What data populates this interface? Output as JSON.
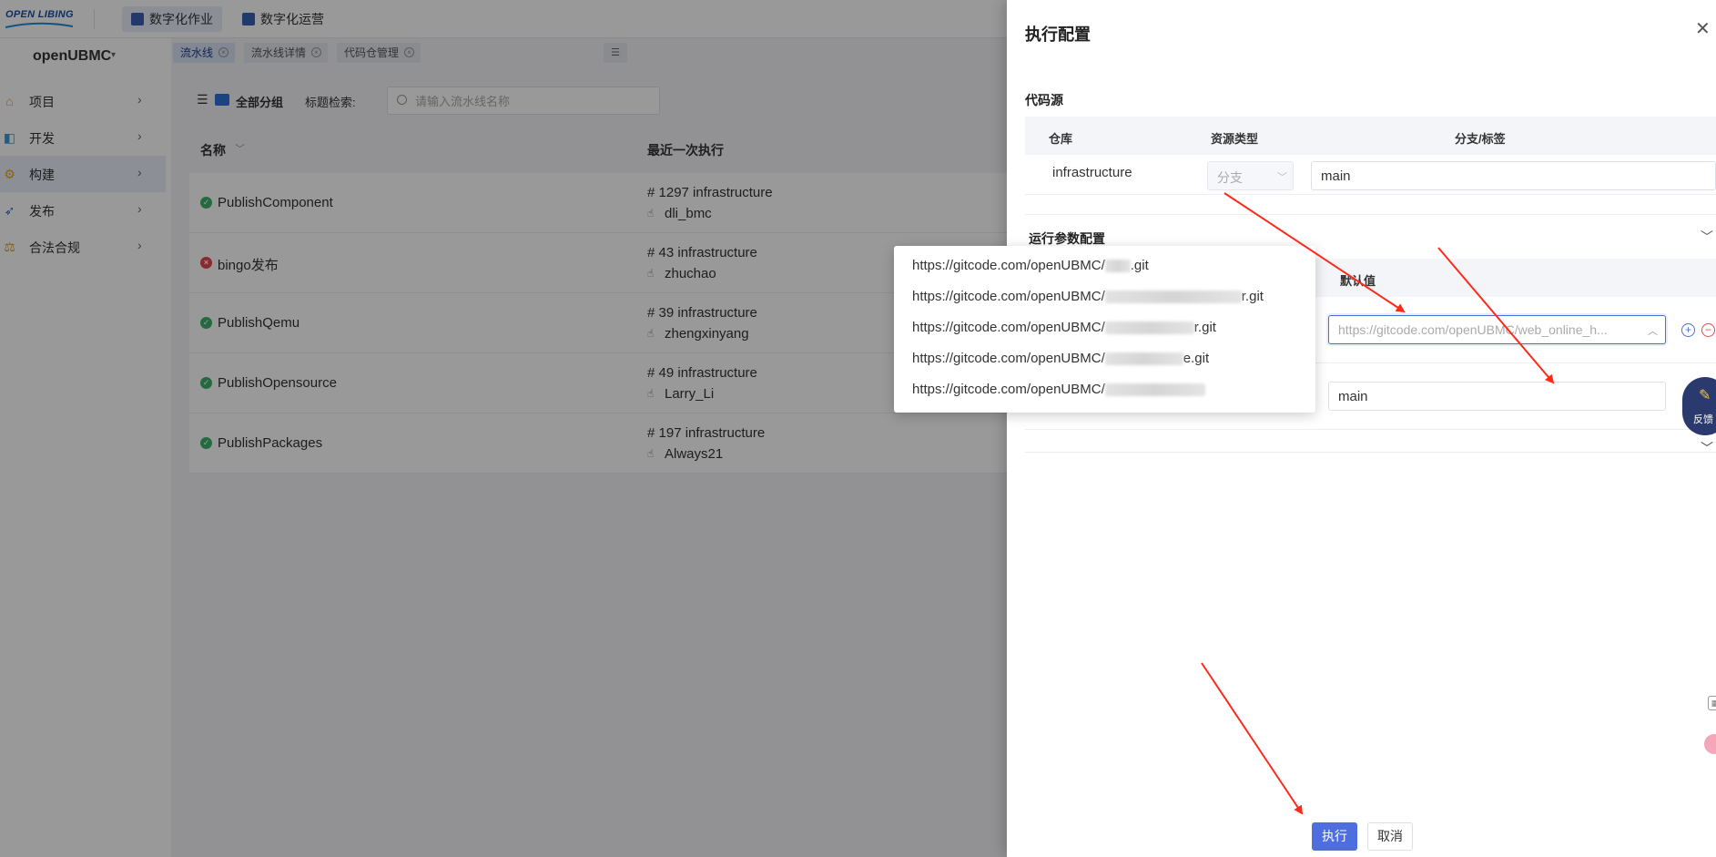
{
  "logo": {
    "text": "OPEN LIBING"
  },
  "top_tabs": [
    {
      "label": "数字化作业"
    },
    {
      "label": "数字化运营"
    }
  ],
  "org": {
    "name": "openUBMC",
    "caret": "▾"
  },
  "sidebar": {
    "items": [
      {
        "label": "项目",
        "icon": "home-icon"
      },
      {
        "label": "开发",
        "icon": "code-icon"
      },
      {
        "label": "构建",
        "icon": "gear-icon"
      },
      {
        "label": "发布",
        "icon": "rocket-icon"
      },
      {
        "label": "合法合规",
        "icon": "scale-icon"
      }
    ]
  },
  "sub_tabs": [
    {
      "label": "流水线"
    },
    {
      "label": "流水线详情"
    },
    {
      "label": "代码仓管理"
    }
  ],
  "filter": {
    "group_label": "全部分组",
    "search_label": "标题检索:",
    "search_placeholder": "请输入流水线名称"
  },
  "pipeline_table": {
    "headers": {
      "name": "名称",
      "last_run": "最近一次执行"
    },
    "rows": [
      {
        "status": "success",
        "name": "PublishComponent",
        "build": "# 1297 infrastructure",
        "user": "dli_bmc"
      },
      {
        "status": "failed",
        "name": "bingo发布",
        "build": "# 43 infrastructure",
        "user": "zhuchao"
      },
      {
        "status": "success",
        "name": "PublishQemu",
        "build": "# 39 infrastructure",
        "user": "zhengxinyang"
      },
      {
        "status": "success",
        "name": "PublishOpensource",
        "build": "# 49 infrastructure",
        "user": "Larry_Li"
      },
      {
        "status": "success",
        "name": "PublishPackages",
        "build": "# 197 infrastructure",
        "user": "Always21"
      }
    ]
  },
  "drawer": {
    "title": "执行配置",
    "code_source": {
      "title": "代码源",
      "headers": {
        "repo": "仓库",
        "type": "资源类型",
        "branch": "分支/标签"
      },
      "row": {
        "repo": "infrastructure",
        "type": "分支",
        "branch": "main"
      }
    },
    "run_params": {
      "title": "运行参数配置",
      "default_header": "默认值",
      "url_value": "https://gitcode.com/openUBMC/web_online_h...",
      "branch_value": "main"
    },
    "feedback_label": "反馈",
    "buttons": {
      "run": "执行",
      "cancel": "取消"
    }
  },
  "dropdown": {
    "items": [
      {
        "prefix": "https://gitcode.com/openUBMC/",
        "suffix": ".git"
      },
      {
        "prefix": "https://gitcode.com/openUBMC/",
        "suffix": "r.git"
      },
      {
        "prefix": "https://gitcode.com/openUBMC/",
        "suffix": "r.git"
      },
      {
        "prefix": "https://gitcode.com/openUBMC/",
        "suffix": "e.git"
      },
      {
        "prefix": "https://gitcode.com/openUBMC/",
        "suffix": ""
      }
    ]
  },
  "colors": {
    "primary": "#4e6ee0",
    "success": "#3fb06b",
    "error": "#e5484d",
    "annotation_arrow": "#ff2a1a"
  }
}
